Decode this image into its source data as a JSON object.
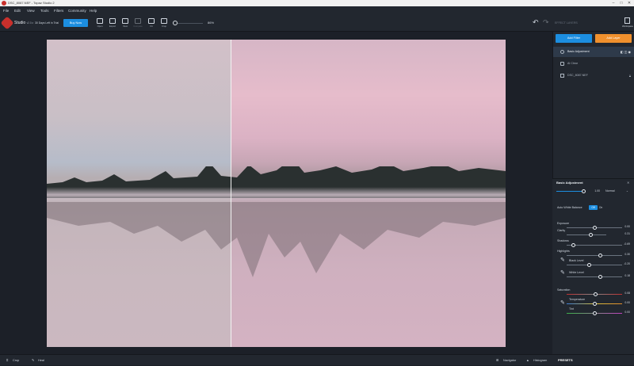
{
  "window": {
    "title": "DSC_8087.NEF - Topaz Studio 2",
    "minimize": "–",
    "maximize": "□",
    "close": "✕"
  },
  "menu": [
    "File",
    "Edit",
    "View",
    "Tools",
    "Filters",
    "Community",
    "Help"
  ],
  "toolbar": {
    "app_name": "Studio",
    "version": "v2.0.x",
    "trial_days": "30 Days Left in Trial",
    "buy_label": "Buy Now",
    "tools": [
      "Open",
      "Export",
      "View",
      "Compare",
      "Fit",
      "Crop"
    ],
    "zoom": "86%",
    "effect_layers": "EFFECT LAYERS",
    "workspace": "Workspace"
  },
  "sidebar": {
    "add_filter": "Add Filter",
    "add_mask": "Add Layer",
    "layers": [
      {
        "name": "Basic Adjustment",
        "active": true
      },
      {
        "name": "AI Clear",
        "active": false
      },
      {
        "name": "DSC_8087.NEF",
        "active": false
      }
    ]
  },
  "panel": {
    "title": "Basic Adjustment",
    "opacity_value": "1.00",
    "blend_mode": "Normal",
    "auto_white_balance": "Auto White Balance",
    "on": "Off",
    "off": "On",
    "sliders": [
      {
        "label": "Exposure",
        "value": "0.00",
        "level": 0.5
      },
      {
        "label": "Clarity",
        "value": "0.31",
        "level": 0.6
      },
      {
        "label": "Shadows",
        "value": "-0.69",
        "level": 0.12
      },
      {
        "label": "Highlights",
        "value": "0.30",
        "level": 0.6
      },
      {
        "label": "Black Level",
        "value": "-0.20",
        "level": 0.4
      },
      {
        "label": "White Level",
        "value": "0.18",
        "level": 0.6
      },
      {
        "label": "Saturation",
        "value": "0.08",
        "level": 0.52
      },
      {
        "label": "Temperature",
        "value": "0.00",
        "level": 0.5
      },
      {
        "label": "Tint",
        "value": "0.00",
        "level": 0.5
      }
    ]
  },
  "bottom": {
    "crop": "Crop",
    "heal": "Heal",
    "navigator": "Navigator",
    "histogram": "Histogram",
    "presets": "PRESETS"
  }
}
